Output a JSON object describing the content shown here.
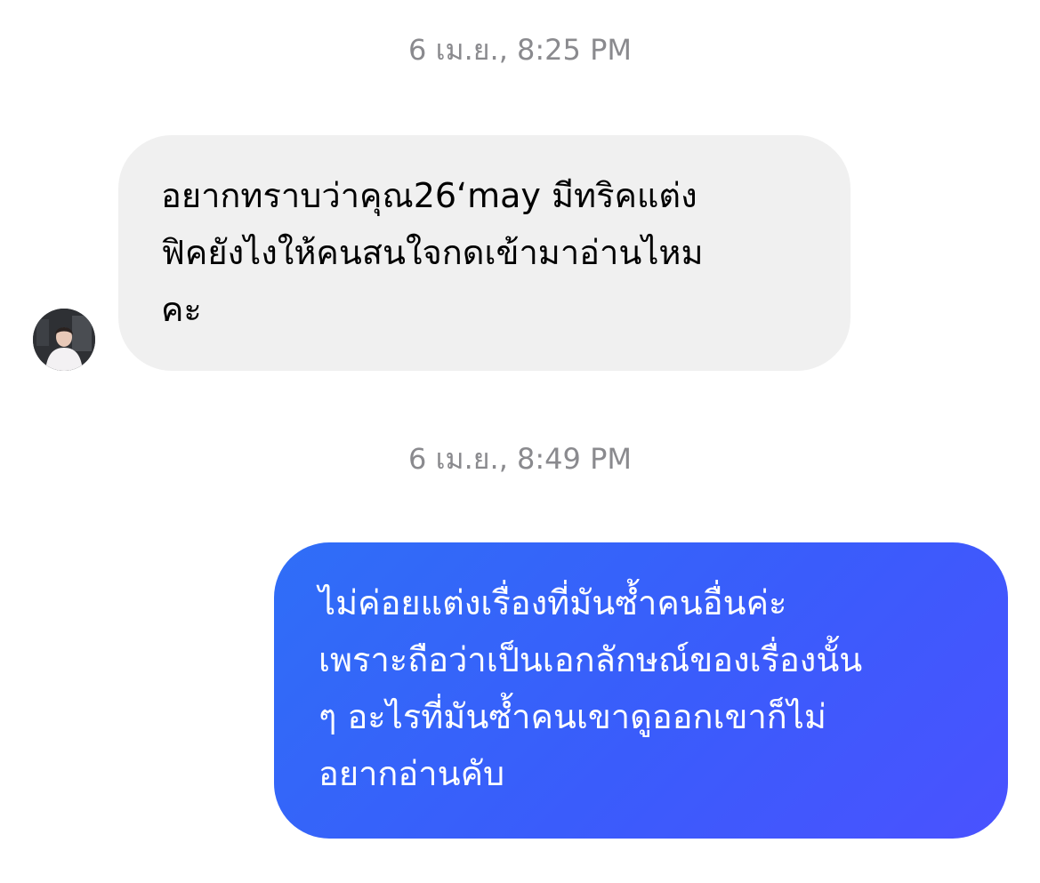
{
  "conversation": {
    "messages": [
      {
        "timestamp": "6 เม.ย., 8:25 PM",
        "direction": "incoming",
        "lines": [
          "อยากทราบว่าคุณ26‘may มีทริคแต่ง",
          "ฟิคยังไงให้คนสนใจกดเข้ามาอ่านไหม",
          "คะ"
        ]
      },
      {
        "timestamp": "6 เม.ย., 8:49 PM",
        "direction": "outgoing",
        "lines": [
          "ไม่ค่อยแต่งเรื่องที่มันซ้ำคนอื่นค่ะ",
          "เพราะถือว่าเป็นเอกลักษณ์ของเรื่องนั้น",
          "ๆ อะไรที่มันซ้ำคนเขาดูออกเขาก็ไม่",
          "อยากอ่านคับ"
        ]
      }
    ]
  },
  "colors": {
    "incoming_bubble": "#f0f0f0",
    "outgoing_bubble": "#3a5cfb",
    "timestamp_text": "#8a8a8e"
  }
}
